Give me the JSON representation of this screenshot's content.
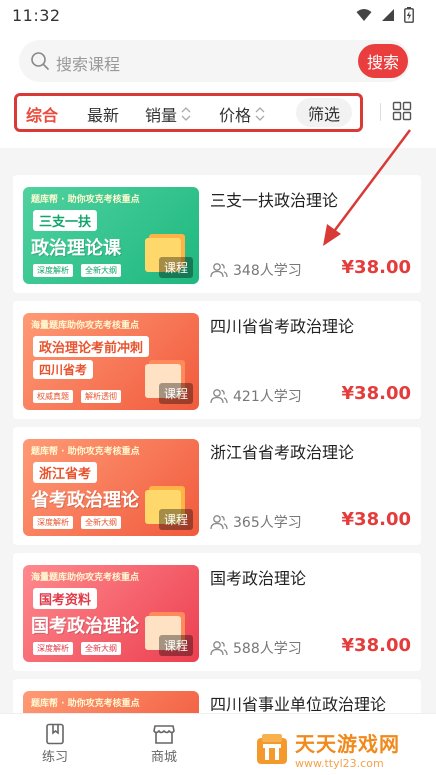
{
  "status": {
    "time": "11:32"
  },
  "search": {
    "placeholder": "搜索课程",
    "button_label": "搜索"
  },
  "filters": {
    "items": [
      {
        "label": "综合",
        "active": true
      },
      {
        "label": "最新"
      },
      {
        "label": "销量"
      },
      {
        "label": "价格"
      }
    ],
    "filter_chip": "筛选"
  },
  "courses": [
    {
      "title": "三支一扶政治理论",
      "learners": "348人学习",
      "price": "¥38.00",
      "thumb": {
        "top": "题库帮 · 助你攻克考核重点",
        "tag": "三支一扶",
        "main": "政治理论课",
        "chips": [
          "深度解析",
          "全新大纲"
        ],
        "badge": "课程"
      }
    },
    {
      "title": "四川省省考政治理论",
      "learners": "421人学习",
      "price": "¥38.00",
      "thumb": {
        "top": "海量题库助你攻克考核重点",
        "tag": "政治理论考前冲刺",
        "sub": "四川省考",
        "chips": [
          "权威真题",
          "解析透彻"
        ],
        "badge": "课程"
      }
    },
    {
      "title": "浙江省省考政治理论",
      "learners": "365人学习",
      "price": "¥38.00",
      "thumb": {
        "top": "题库帮 · 助你攻克考核重点",
        "tag": "浙江省考",
        "main": "省考政治理论",
        "chips": [
          "深度解析",
          "全新大纲"
        ],
        "badge": "课程"
      }
    },
    {
      "title": "国考政治理论",
      "learners": "588人学习",
      "price": "¥38.00",
      "thumb": {
        "top": "海量题库助你攻克考核重点",
        "tag": "国考资料",
        "main": "国考政治理论",
        "chips": [
          "深度解析",
          "全新大纲"
        ],
        "badge": "课程"
      }
    },
    {
      "title": "四川省事业单位政治理论",
      "thumb": {
        "top": "题库帮 · 助你攻克考核重点"
      }
    }
  ],
  "tabbar": {
    "items": [
      {
        "label": "练习"
      },
      {
        "label": "商城"
      }
    ]
  },
  "watermark": {
    "name": "天天游戏网",
    "url": "www.ttyl23.com"
  },
  "colors": {
    "accent": "#ea3d3d",
    "price": "#e43b3b",
    "active_filter": "#ea4b3c",
    "annotation": "#d93a36"
  }
}
